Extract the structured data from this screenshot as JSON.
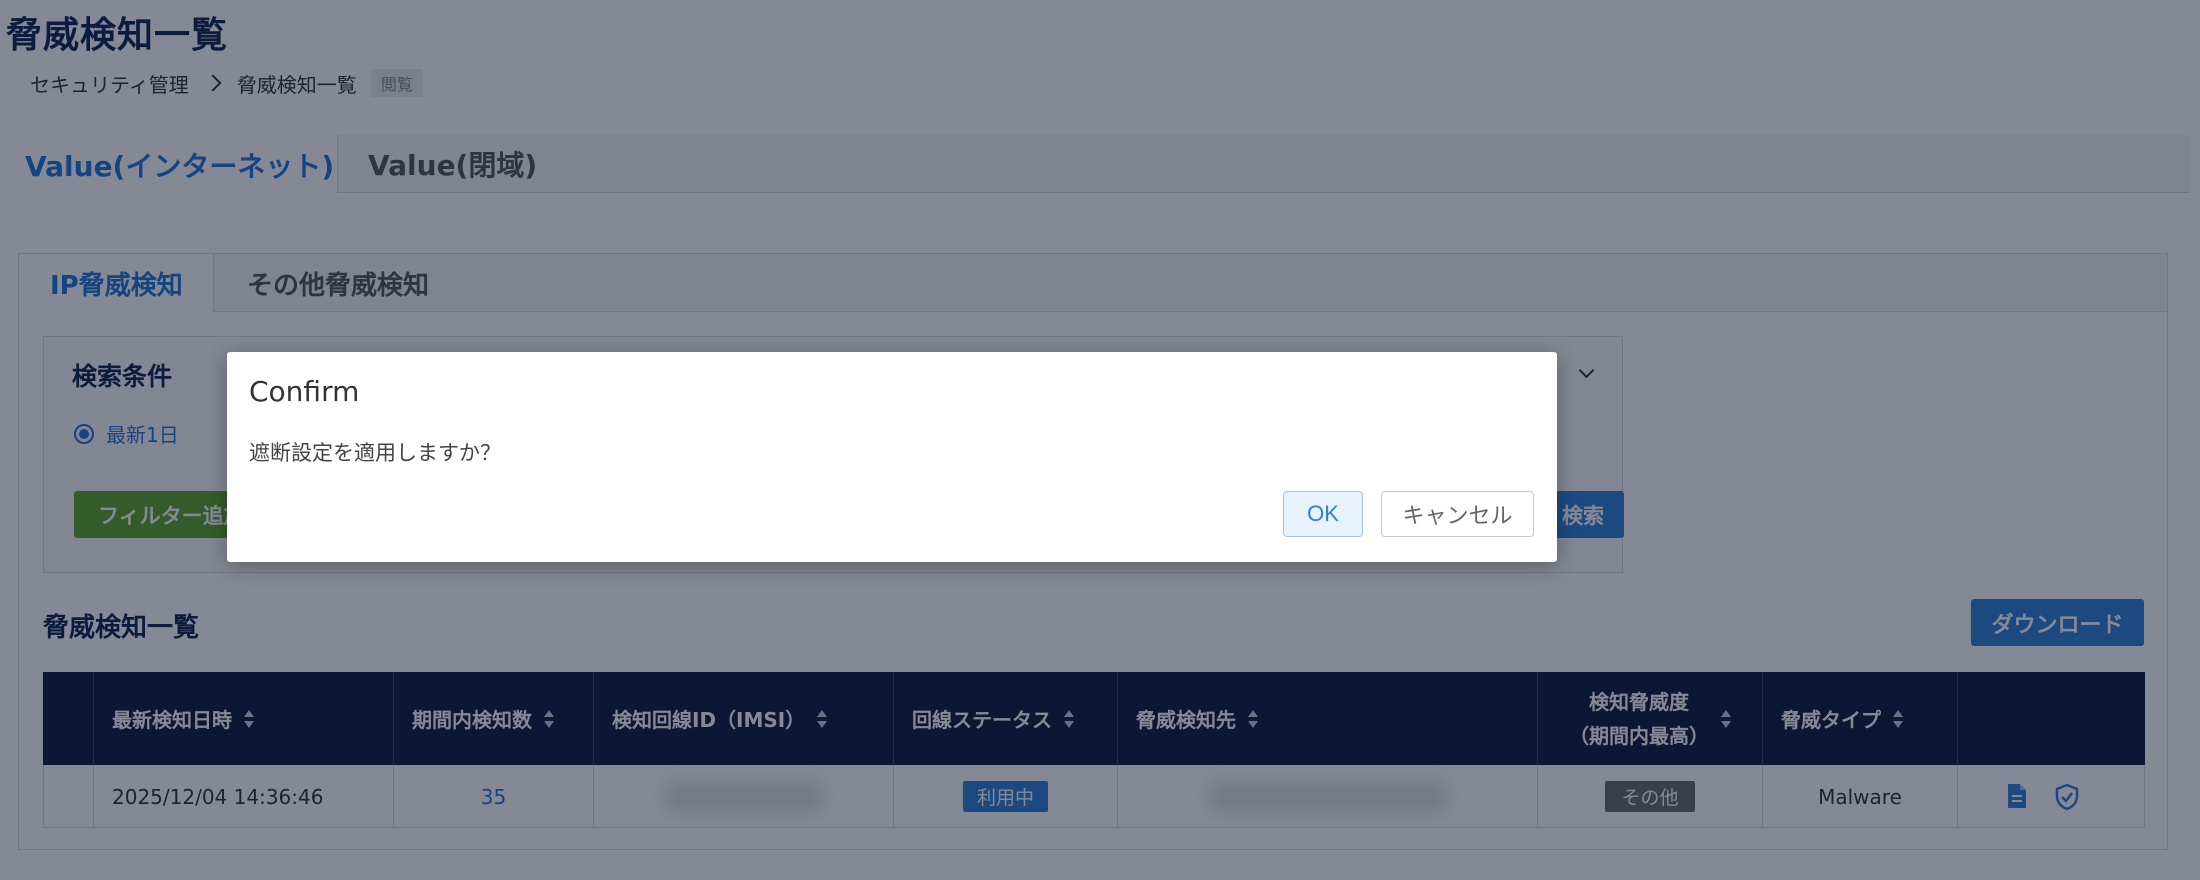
{
  "page": {
    "title": "脅威検知一覧",
    "breadcrumb": [
      "セキュリティ管理",
      "脅威検知一覧"
    ],
    "access_badge": "閲覧"
  },
  "outer_tabs": [
    {
      "label": "Value(インターネット)",
      "active": true
    },
    {
      "label": "Value(閉域)",
      "active": false
    }
  ],
  "inner_tabs": [
    {
      "label": "IP脅威検知",
      "active": true
    },
    {
      "label": "その他脅威検知",
      "active": false
    }
  ],
  "search": {
    "title": "検索条件",
    "radio_selected": "最新1日",
    "filter_button": "フィルター追加",
    "search_button": "検索"
  },
  "list": {
    "title": "脅威検知一覧",
    "download_button": "ダウンロード",
    "columns": [
      "",
      "最新検知日時",
      "期間内検知数",
      "検知回線ID（IMSI）",
      "回線ステータス",
      "脅威検知先",
      "検知脅威度\n（期間内最高）",
      "脅威タイプ",
      ""
    ],
    "rows": [
      {
        "datetime": "2025/12/04 14:36:46",
        "count": "35",
        "status": "利用中",
        "severity": "その他",
        "threat_type": "Malware"
      }
    ]
  },
  "modal": {
    "title": "Confirm",
    "message": "遮断設定を適用しますか？",
    "ok_label": "OK",
    "cancel_label": "キャンセル"
  },
  "colors": {
    "primary": "#2f7fd6",
    "navy": "#0a1a3c",
    "green": "#5ca52a"
  }
}
